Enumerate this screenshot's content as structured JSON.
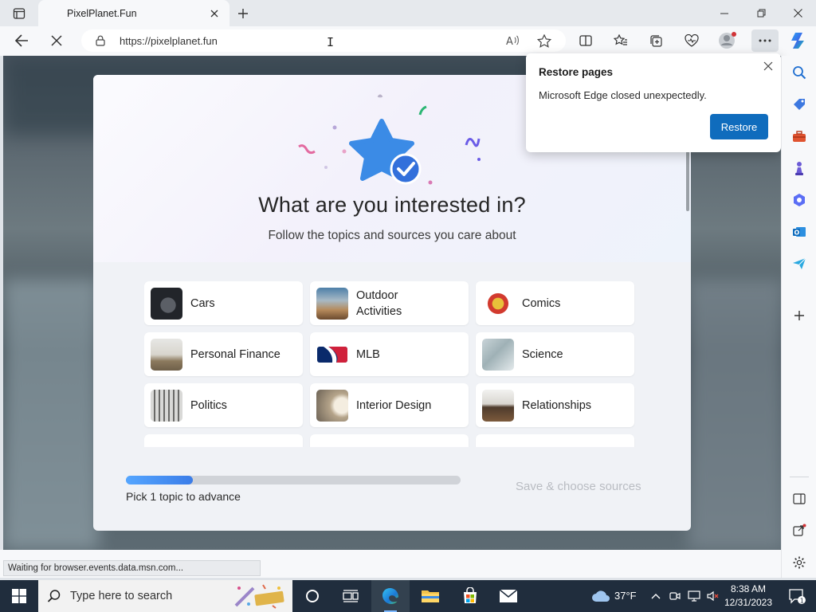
{
  "browser": {
    "tab": {
      "title": "PixelPlanet.Fun"
    },
    "address": {
      "url": "https://pixelplanet.fun"
    }
  },
  "modal": {
    "title": "What are you interested in?",
    "subtitle": "Follow the topics and sources you care about",
    "topics": [
      {
        "label": "Cars",
        "thumb": "cars"
      },
      {
        "label": "Outdoor Activities",
        "thumb": "outdoor"
      },
      {
        "label": "Comics",
        "thumb": "comics"
      },
      {
        "label": "Personal Finance",
        "thumb": "finance"
      },
      {
        "label": "MLB",
        "thumb": "mlb"
      },
      {
        "label": "Science",
        "thumb": "science"
      },
      {
        "label": "Politics",
        "thumb": "politics"
      },
      {
        "label": "Interior Design",
        "thumb": "interior"
      },
      {
        "label": "Relationships",
        "thumb": "relationships"
      }
    ],
    "progress": {
      "fraction": 0.2,
      "label": "Pick 1 topic to advance"
    },
    "save_label": "Save & choose sources"
  },
  "restore_popup": {
    "title": "Restore pages",
    "message": "Microsoft Edge closed unexpectedly.",
    "button": "Restore"
  },
  "status": {
    "text": "Waiting for browser.events.data.msn.com..."
  },
  "taskbar": {
    "search_placeholder": "Type here to search",
    "weather": "37°F",
    "time": "8:38 AM",
    "date": "12/31/2023",
    "notification_count": "1"
  },
  "colors": {
    "accent": "#0f6cbd",
    "taskbar": "#202d3d",
    "progress": "#3b7de8"
  }
}
